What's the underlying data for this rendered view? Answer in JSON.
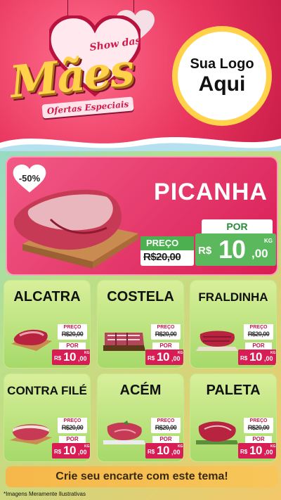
{
  "header": {
    "title_top": "Show das",
    "title_main": "Mães",
    "title_sub": "Ofertas Especiais",
    "logo_line1": "Sua Logo",
    "logo_line2": "Aqui"
  },
  "featured": {
    "discount": "-50%",
    "name": "PICANHA",
    "old_label": "PREÇO",
    "old_price": "R$20,00",
    "new_label": "POR",
    "currency": "R$",
    "price_int": "10",
    "price_dec": ",00",
    "unit": "KG"
  },
  "products": [
    {
      "name": "ALCATRA",
      "old_label": "PREÇO",
      "old_price": "R$20,00",
      "new_label": "POR",
      "currency": "R$",
      "price_int": "10",
      "price_dec": ",00",
      "unit": "KG"
    },
    {
      "name": "COSTELA",
      "old_label": "PREÇO",
      "old_price": "R$20,00",
      "new_label": "POR",
      "currency": "R$",
      "price_int": "10",
      "price_dec": ",00",
      "unit": "KG"
    },
    {
      "name": "FRALDINHA",
      "old_label": "PREÇO",
      "old_price": "R$20,00",
      "new_label": "POR",
      "currency": "R$",
      "price_int": "10",
      "price_dec": ",00",
      "unit": "KG"
    },
    {
      "name": "CONTRA FILÉ",
      "old_label": "PREÇO",
      "old_price": "R$20,00",
      "new_label": "POR",
      "currency": "R$",
      "price_int": "10",
      "price_dec": ",00",
      "unit": "KG"
    },
    {
      "name": "ACÉM",
      "old_label": "PREÇO",
      "old_price": "R$20,00",
      "new_label": "POR",
      "currency": "R$",
      "price_int": "10",
      "price_dec": ",00",
      "unit": "KG"
    },
    {
      "name": "PALETA",
      "old_label": "PREÇO",
      "old_price": "R$20,00",
      "new_label": "POR",
      "currency": "R$",
      "price_int": "10",
      "price_dec": ",00",
      "unit": "KG"
    }
  ],
  "footer": {
    "cta": "Crie seu encarte com este tema!",
    "disclaimer": "*Imagens Meramente Ilustrativas"
  },
  "colors": {
    "header_pink": "#e9365f",
    "title_gold": "#ffd24a",
    "price_green": "#5cb85c",
    "price_pink": "#d81d55",
    "card_green": "#a6d96a",
    "cta_orange": "#f6b74a"
  }
}
